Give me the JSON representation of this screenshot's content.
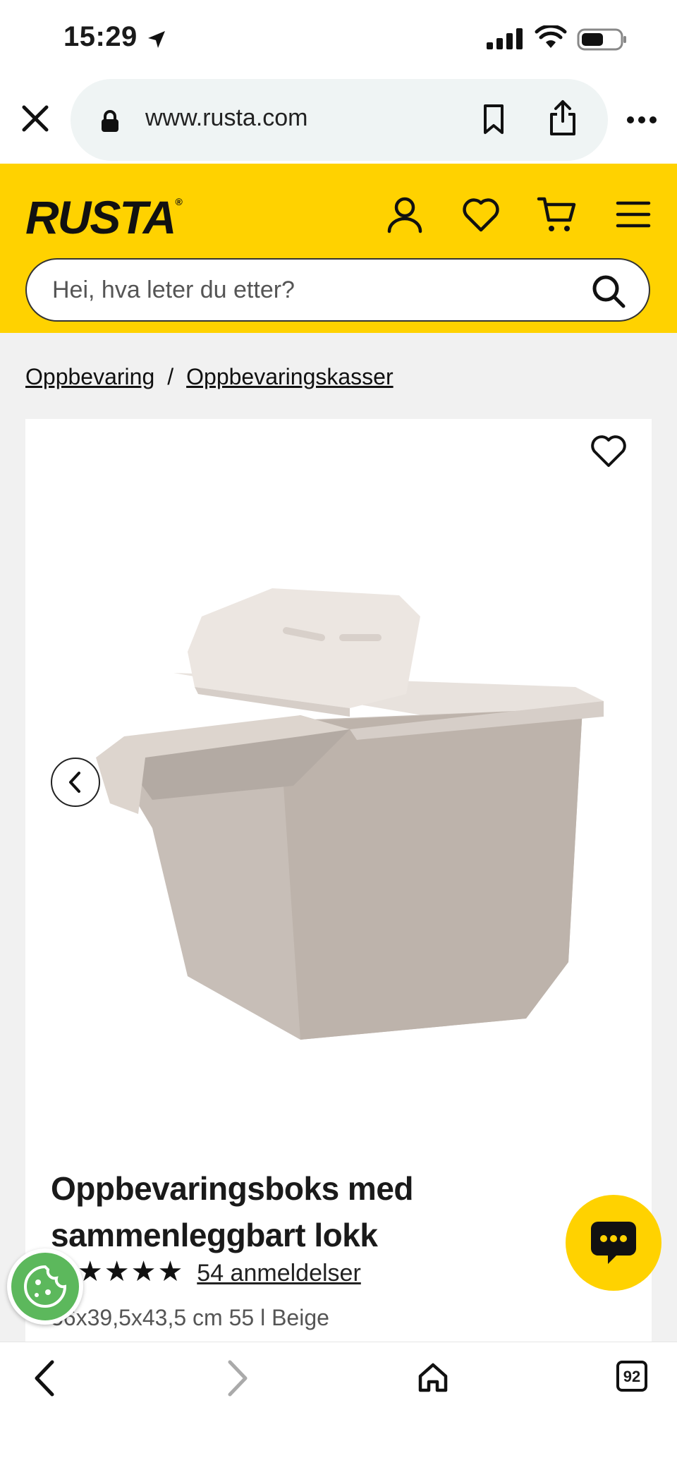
{
  "status": {
    "time": "15:29"
  },
  "browser": {
    "url": "www.rusta.com",
    "tabs_count": "92"
  },
  "header": {
    "brand": "RUSTA",
    "brand_mark": "®",
    "search_placeholder": "Hei, hva leter du etter?",
    "accent_color": "#ffd200"
  },
  "breadcrumb": {
    "items": [
      "Oppbevaring",
      "Oppbevaringskasser"
    ],
    "separator": "/"
  },
  "product": {
    "title": "Oppbevaringsboks med sammenleggbart lokk",
    "stars": "★★★★★",
    "rating_out_of_5": 5,
    "reviews": "54 anmeldelser",
    "variant": "56x39,5x43,5 cm 55 l Beige"
  },
  "icons": {
    "location": "location-arrow-icon",
    "signal": "signal-icon",
    "wifi": "wifi-icon",
    "battery": "battery-icon",
    "close": "close-icon",
    "lock": "lock-icon",
    "bookmark": "bookmark-icon",
    "share": "share-icon",
    "more": "more-icon",
    "account": "user-icon",
    "favorites": "heart-icon",
    "cart": "cart-icon",
    "menu": "hamburger-icon",
    "search": "search-icon",
    "prev": "chevron-left-icon",
    "chat": "chat-icon",
    "cookie": "cookie-icon",
    "home": "home-icon"
  }
}
